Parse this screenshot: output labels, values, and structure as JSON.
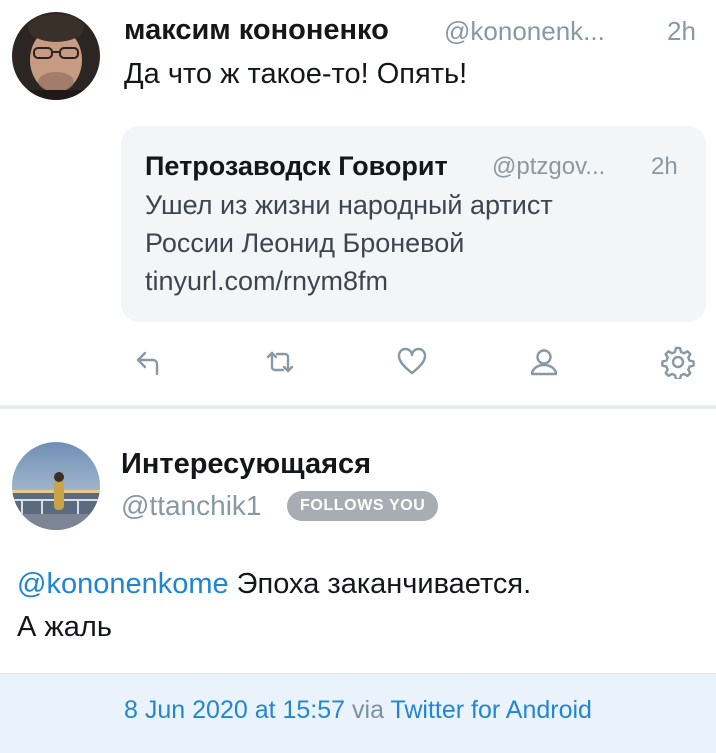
{
  "tweet": {
    "author_name": "максим кононенко",
    "author_handle": "@kononenk...",
    "time": "2h",
    "text": "Да что ж такое-то! Опять!",
    "quote": {
      "author_name": "Петрозаводск Говорит",
      "author_handle": "@ptzgov...",
      "time": "2h",
      "lines": [
        "Ушел из жизни народный артист",
        "России Леонид Броневой",
        "tinyurl.com/rnym8fm"
      ]
    },
    "actions": [
      "reply-icon",
      "retweet-icon",
      "heart-icon",
      "person-icon",
      "gear-icon"
    ]
  },
  "reply": {
    "author_name": "Интересующаяся",
    "author_handle": "@ttanchik1",
    "badge": "FOLLOWS YOU",
    "mention": "@kononenkome",
    "text_rest": " Эпоха заканчивается.",
    "text_line2": "А жаль",
    "date": "8 Jun 2020 at 15:57",
    "via_word": "via",
    "client": "Twitter for Android"
  },
  "colors": {
    "link_blue": "#1c85d6",
    "gray_text": "#8899a6",
    "badge_bg": "#a7adb3",
    "footer_bg": "#eaf3fb",
    "quote_bg": "#f3f5f7"
  }
}
